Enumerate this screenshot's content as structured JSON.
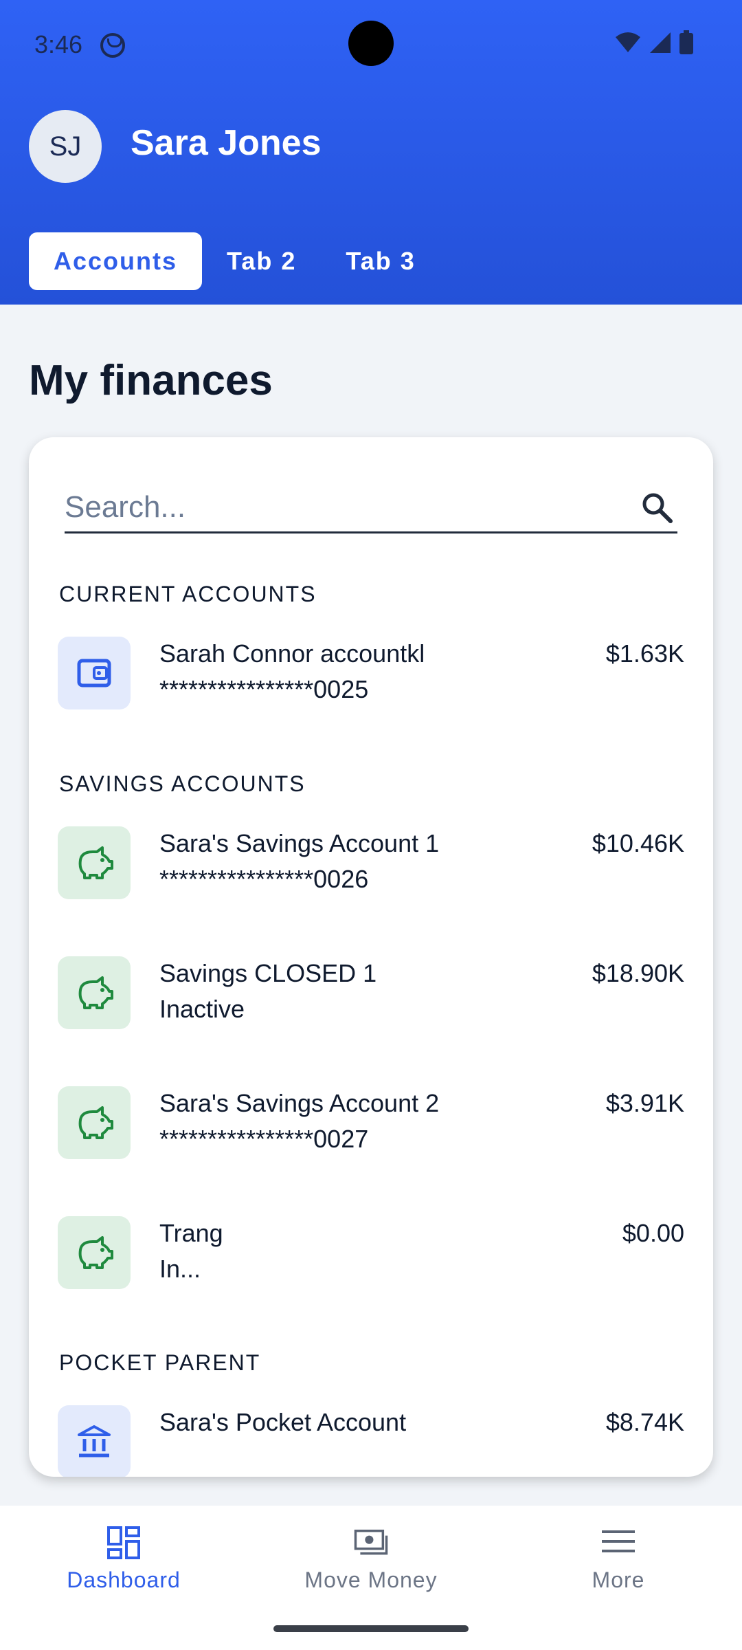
{
  "status": {
    "time": "3:46"
  },
  "user": {
    "initials": "SJ",
    "name": "Sara Jones"
  },
  "tabs": [
    {
      "label": "Accounts",
      "active": true
    },
    {
      "label": "Tab 2",
      "active": false
    },
    {
      "label": "Tab 3",
      "active": false
    }
  ],
  "page": {
    "title": "My finances"
  },
  "search": {
    "placeholder": "Search...",
    "value": ""
  },
  "groups": {
    "current": "CURRENT ACCOUNTS",
    "savings": "SAVINGS ACCOUNTS",
    "pocket": "POCKET PARENT"
  },
  "accounts": {
    "current": [
      {
        "name": "Sarah Connor accountkl",
        "sub": "****************0025",
        "amount": "$1.63K",
        "icon": "wallet-icon"
      }
    ],
    "savings": [
      {
        "name": "Sara's Savings Account 1",
        "sub": "****************0026",
        "amount": "$10.46K",
        "icon": "piggy-bank-icon"
      },
      {
        "name": "Savings CLOSED 1",
        "sub": "Inactive",
        "amount": "$18.90K",
        "icon": "piggy-bank-icon"
      },
      {
        "name": "Sara's Savings Account 2",
        "sub": "****************0027",
        "amount": "$3.91K",
        "icon": "piggy-bank-icon"
      },
      {
        "name": "Trang",
        "sub": "In...",
        "amount": "$0.00",
        "icon": "piggy-bank-icon"
      }
    ],
    "pocket": [
      {
        "name": "Sara's Pocket Account",
        "sub": "",
        "amount": "$8.74K",
        "icon": "bank-icon"
      }
    ]
  },
  "nav": [
    {
      "label": "Dashboard",
      "icon": "dashboard-icon",
      "active": true
    },
    {
      "label": "Move Money",
      "icon": "money-icon",
      "active": false
    },
    {
      "label": "More",
      "icon": "menu-icon",
      "active": false
    }
  ],
  "colors": {
    "primary": "#2f5ee9",
    "savings_icon": "#1f8a3e",
    "current_icon": "#2f5ee9"
  }
}
